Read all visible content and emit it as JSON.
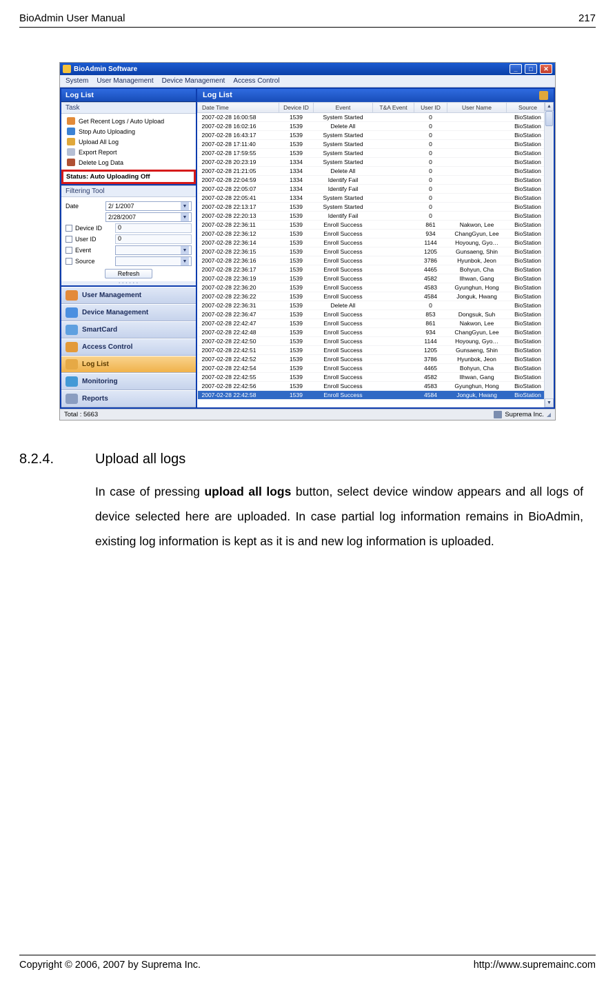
{
  "header": {
    "left": "BioAdmin  User  Manual",
    "right": "217"
  },
  "footer": {
    "left": "Copyright © 2006, 2007 by Suprema Inc.",
    "right": "http://www.supremainc.com"
  },
  "section": {
    "number": "8.2.4.",
    "title": "Upload all logs",
    "text": "In case of pressing upload all logs button, select device window appears and all logs of device selected here are uploaded. In case partial log information remains in BioAdmin, existing log information is kept as it is and new log information is uploaded.",
    "bold_span": "upload all logs"
  },
  "app": {
    "title": "BioAdmin Software",
    "menus": [
      "System",
      "User Management",
      "Device Management",
      "Access Control"
    ],
    "sidebar": {
      "loglist_label": "Log List",
      "task_label": "Task",
      "tasks": [
        "Get Recent Logs / Auto Upload",
        "Stop Auto Uploading",
        "Upload All Log",
        "Export Report",
        "Delete Log Data"
      ],
      "status_text": "Status: Auto Uploading Off",
      "filter_label": "Filtering Tool",
      "filter": {
        "date_label": "Date",
        "date1": "2/ 1/2007",
        "date2": "2/28/2007",
        "device_label": "Device ID",
        "device_val": "0",
        "user_label": "User ID",
        "user_val": "0",
        "event_label": "Event",
        "source_label": "Source",
        "refresh": "Refresh"
      },
      "nav": [
        "User Management",
        "Device Management",
        "SmartCard",
        "Access Control",
        "Log List",
        "Monitoring",
        "Reports"
      ],
      "active_nav": 4
    },
    "main": {
      "title": "Log List",
      "columns": [
        "Date Time",
        "Device ID",
        "Event",
        "T&&A Event",
        "User ID",
        "User Name",
        "Source"
      ],
      "col_widths": [
        "118",
        "50",
        "86",
        "60",
        "48",
        "86",
        "62"
      ],
      "rows": [
        [
          "2007-02-28 16:00:58",
          "1539",
          "System Started",
          "",
          "0",
          "",
          "BioStation"
        ],
        [
          "2007-02-28 16:02:16",
          "1539",
          "Delete All",
          "",
          "0",
          "",
          "BioStation"
        ],
        [
          "2007-02-28 16:43:17",
          "1539",
          "System Started",
          "",
          "0",
          "",
          "BioStation"
        ],
        [
          "2007-02-28 17:11:40",
          "1539",
          "System Started",
          "",
          "0",
          "",
          "BioStation"
        ],
        [
          "2007-02-28 17:59:55",
          "1539",
          "System Started",
          "",
          "0",
          "",
          "BioStation"
        ],
        [
          "2007-02-28 20:23:19",
          "1334",
          "System Started",
          "",
          "0",
          "",
          "BioStation"
        ],
        [
          "2007-02-28 21:21:05",
          "1334",
          "Delete All",
          "",
          "0",
          "",
          "BioStation"
        ],
        [
          "2007-02-28 22:04:59",
          "1334",
          "Identify Fail",
          "",
          "0",
          "",
          "BioStation"
        ],
        [
          "2007-02-28 22:05:07",
          "1334",
          "Identify Fail",
          "",
          "0",
          "",
          "BioStation"
        ],
        [
          "2007-02-28 22:05:41",
          "1334",
          "System Started",
          "",
          "0",
          "",
          "BioStation"
        ],
        [
          "2007-02-28 22:13:17",
          "1539",
          "System Started",
          "",
          "0",
          "",
          "BioStation"
        ],
        [
          "2007-02-28 22:20:13",
          "1539",
          "Identify Fail",
          "",
          "0",
          "",
          "BioStation"
        ],
        [
          "2007-02-28 22:36:11",
          "1539",
          "Enroll Success",
          "",
          "861",
          "Nakwon, Lee",
          "BioStation"
        ],
        [
          "2007-02-28 22:36:12",
          "1539",
          "Enroll Success",
          "",
          "934",
          "ChangGyun, Lee",
          "BioStation"
        ],
        [
          "2007-02-28 22:36:14",
          "1539",
          "Enroll Success",
          "",
          "1144",
          "Hoyoung, Gyo…",
          "BioStation"
        ],
        [
          "2007-02-28 22:36:15",
          "1539",
          "Enroll Success",
          "",
          "1205",
          "Gunsaeng, Shin",
          "BioStation"
        ],
        [
          "2007-02-28 22:36:16",
          "1539",
          "Enroll Success",
          "",
          "3786",
          "Hyunbok, Jeon",
          "BioStation"
        ],
        [
          "2007-02-28 22:36:17",
          "1539",
          "Enroll Success",
          "",
          "4465",
          "Bohyun, Cha",
          "BioStation"
        ],
        [
          "2007-02-28 22:36:19",
          "1539",
          "Enroll Success",
          "",
          "4582",
          "Ilhwan, Gang",
          "BioStation"
        ],
        [
          "2007-02-28 22:36:20",
          "1539",
          "Enroll Success",
          "",
          "4583",
          "Gyunghun, Hong",
          "BioStation"
        ],
        [
          "2007-02-28 22:36:22",
          "1539",
          "Enroll Success",
          "",
          "4584",
          "Jonguk, Hwang",
          "BioStation"
        ],
        [
          "2007-02-28 22:36:31",
          "1539",
          "Delete All",
          "",
          "0",
          "",
          "BioStation"
        ],
        [
          "2007-02-28 22:36:47",
          "1539",
          "Enroll Success",
          "",
          "853",
          "Dongsuk, Suh",
          "BioStation"
        ],
        [
          "2007-02-28 22:42:47",
          "1539",
          "Enroll Success",
          "",
          "861",
          "Nakwon, Lee",
          "BioStation"
        ],
        [
          "2007-02-28 22:42:48",
          "1539",
          "Enroll Success",
          "",
          "934",
          "ChangGyun, Lee",
          "BioStation"
        ],
        [
          "2007-02-28 22:42:50",
          "1539",
          "Enroll Success",
          "",
          "1144",
          "Hoyoung, Gyo…",
          "BioStation"
        ],
        [
          "2007-02-28 22:42:51",
          "1539",
          "Enroll Success",
          "",
          "1205",
          "Gunsaeng, Shin",
          "BioStation"
        ],
        [
          "2007-02-28 22:42:52",
          "1539",
          "Enroll Success",
          "",
          "3786",
          "Hyunbok, Jeon",
          "BioStation"
        ],
        [
          "2007-02-28 22:42:54",
          "1539",
          "Enroll Success",
          "",
          "4465",
          "Bohyun, Cha",
          "BioStation"
        ],
        [
          "2007-02-28 22:42:55",
          "1539",
          "Enroll Success",
          "",
          "4582",
          "Ilhwan, Gang",
          "BioStation"
        ],
        [
          "2007-02-28 22:42:56",
          "1539",
          "Enroll Success",
          "",
          "4583",
          "Gyunghun, Hong",
          "BioStation"
        ],
        [
          "2007-02-28 22:42:58",
          "1539",
          "Enroll Success",
          "",
          "4584",
          "Jonguk, Hwang",
          "BioStation"
        ]
      ],
      "selected_row": 31
    },
    "statusbar": {
      "left": "Total : 5663",
      "right": "Suprema Inc."
    }
  }
}
